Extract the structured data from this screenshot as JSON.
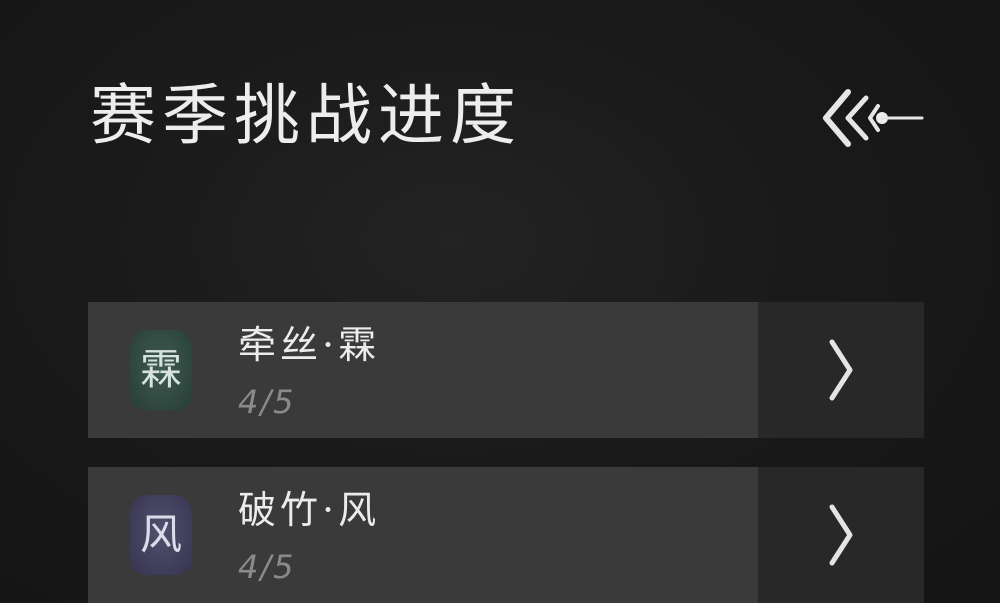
{
  "header": {
    "title": "赛季挑战进度",
    "back_icon": "back-arrow-icon"
  },
  "challenges": [
    {
      "seal_char": "霖",
      "seal_color": "#2e463f",
      "name": "牵丝·霖",
      "progress": "4/5",
      "arrow_icon": "chevron-right-icon"
    },
    {
      "seal_char": "风",
      "seal_color": "#3e3c58",
      "name": "破竹·风",
      "progress": "4/5",
      "arrow_icon": "chevron-right-icon"
    }
  ]
}
